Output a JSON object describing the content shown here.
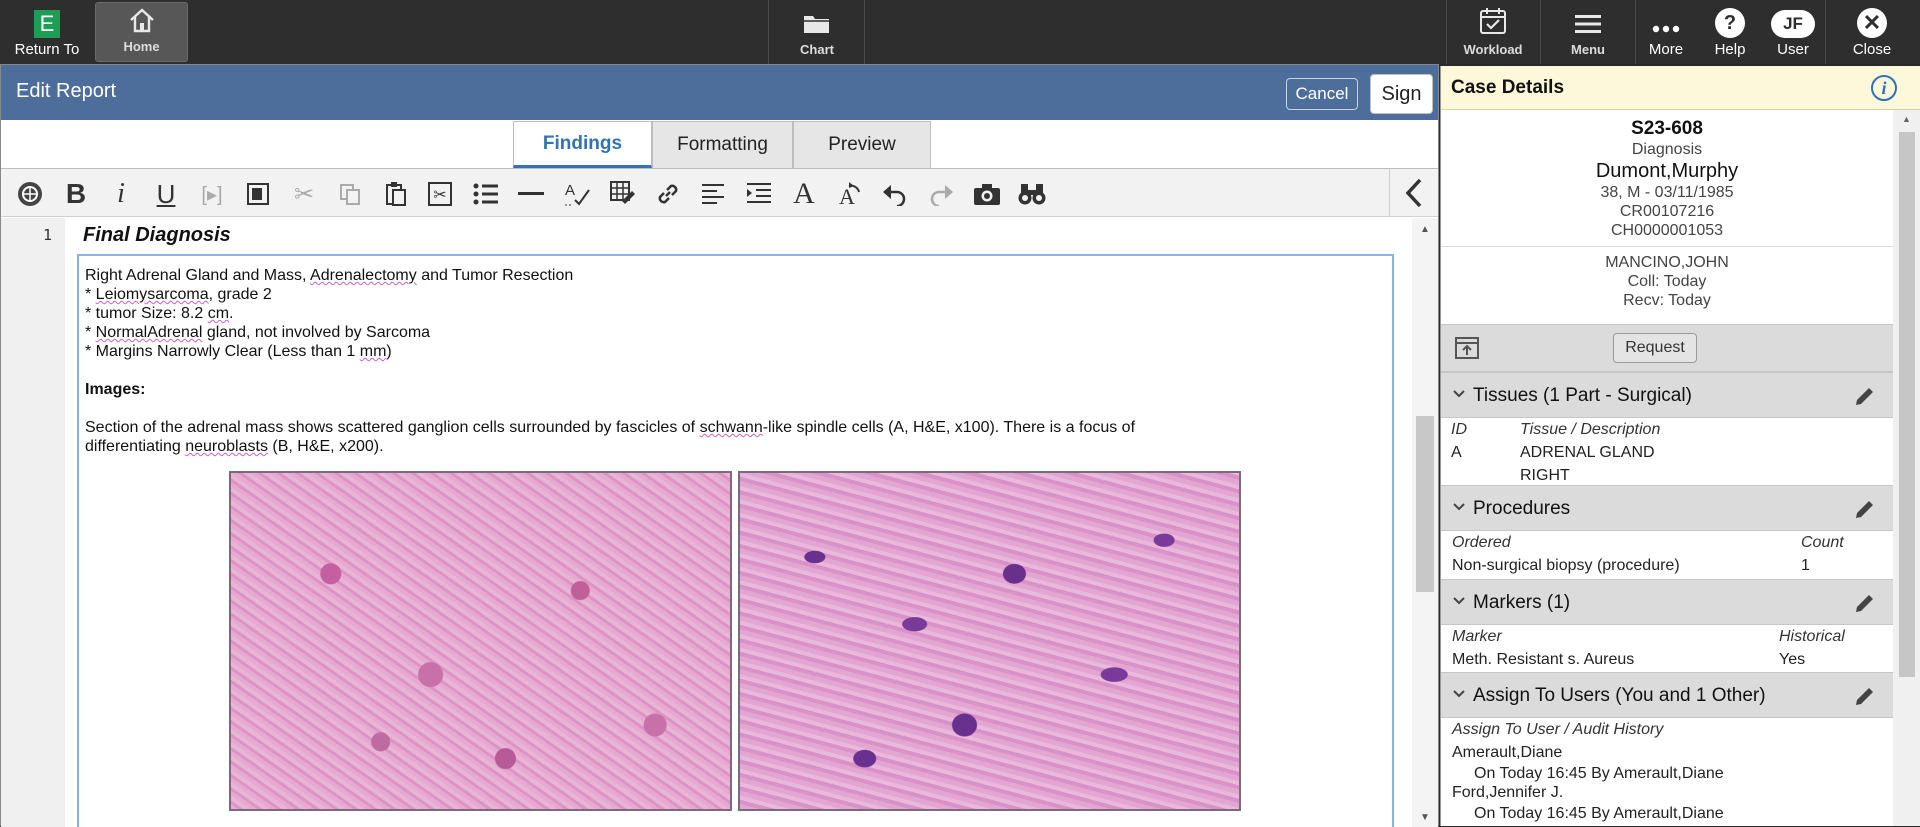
{
  "topbar": {
    "return_to": "Return To",
    "return_badge": "E",
    "home": "Home",
    "chart": "Chart",
    "workload": "Workload",
    "menu": "Menu",
    "more": "More",
    "help": "Help",
    "user": "User",
    "user_initials": "JF",
    "close": "Close"
  },
  "editor": {
    "title": "Edit Report",
    "cancel": "Cancel",
    "sign": "Sign",
    "tabs": [
      {
        "label": "Findings",
        "active": true
      },
      {
        "label": "Formatting",
        "active": false
      },
      {
        "label": "Preview",
        "active": false
      }
    ],
    "line_number": "1",
    "section_title": "Final Diagnosis",
    "lines": {
      "l1a": "Right Adrenal Gland and Mass, ",
      "l1b": "Adrenalectomy",
      "l1c": " and Tumor Resection",
      "l2a": "* ",
      "l2b": "Leiomysarcoma",
      "l2c": ", grade 2",
      "l3a": "* tumor Size: 8.2 ",
      "l3b": "cm",
      "l3c": ".",
      "l4a": "* ",
      "l4b": "NormalAdrenal",
      "l4c": " gland, not involved by Sarcoma",
      "l5a": "* Margins Narrowly Clear (Less than 1 ",
      "l5b": "mm",
      "l5c": ")",
      "images_heading": "Images:",
      "p1a": "Section of the adrenal mass shows scattered ganglion cells surrounded by fascicles of ",
      "p1b": "schwann",
      "p1c": "-like spindle cells (A, H&E, x100). There is a focus of",
      "p2a": "differentiating ",
      "p2b": "neuroblasts",
      "p2c": " (B, H&E, x200)."
    }
  },
  "case": {
    "header": "Case Details",
    "case_id": "S23-608",
    "case_type": "Diagnosis",
    "patient_name": "Dumont,Murphy",
    "patient_demo": "38, M - 03/11/1985",
    "cr_number": "CR00107216",
    "ch_number": "CH0000001053",
    "provider": "MANCINO,JOHN",
    "coll": "Coll: Today",
    "recv": "Recv: Today",
    "request": "Request",
    "tissues": {
      "title": "Tissues (1 Part - Surgical)",
      "col_id": "ID",
      "col_desc": "Tissue / Description",
      "id": "A",
      "desc1": "ADRENAL GLAND",
      "desc2": "RIGHT"
    },
    "procedures": {
      "title": "Procedures",
      "col_ordered": "Ordered",
      "col_count": "Count",
      "name": "Non-surgical biopsy (procedure)",
      "count": "1"
    },
    "markers": {
      "title": "Markers (1)",
      "col_marker": "Marker",
      "col_hist": "Historical",
      "name": "Meth. Resistant s. Aureus",
      "hist": "Yes"
    },
    "assign": {
      "title": "Assign To Users (You and 1 Other)",
      "col": "Assign To User / Audit History",
      "u1": "Amerault,Diane",
      "u1_hist": "On Today 16:45 By Amerault,Diane",
      "u2": "Ford,Jennifer J.",
      "u2_hist": "On Today 16:45 By Amerault,Diane"
    }
  }
}
